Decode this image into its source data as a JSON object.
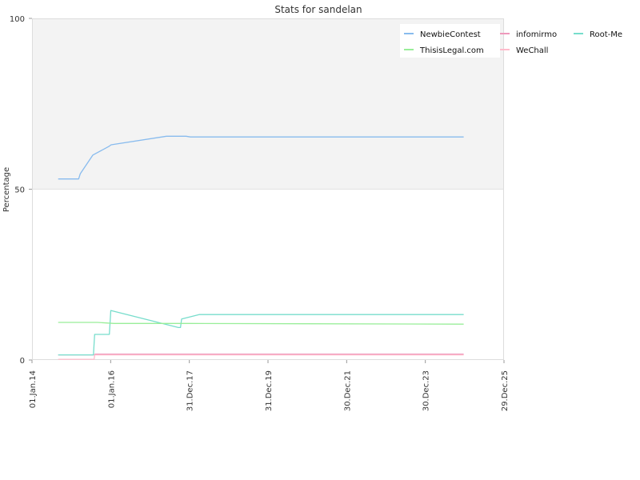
{
  "chart_data": {
    "type": "line",
    "title": "Stats for sandelan",
    "xlabel": "",
    "ylabel": "Percentage",
    "ylim": [
      0,
      100
    ],
    "yticks": [
      0,
      50,
      100
    ],
    "xlim": [
      "2014-01-01",
      "2025-12-29"
    ],
    "xticks": [
      {
        "date": "2014-01-01",
        "label": "01.Jan.14"
      },
      {
        "date": "2016-01-01",
        "label": "01.Jan.16"
      },
      {
        "date": "2017-12-31",
        "label": "31.Dec.17"
      },
      {
        "date": "2019-12-31",
        "label": "31.Dec.19"
      },
      {
        "date": "2021-12-30",
        "label": "30.Dec.21"
      },
      {
        "date": "2023-12-30",
        "label": "30.Dec.23"
      },
      {
        "date": "2025-12-29",
        "label": "29.Dec.25"
      }
    ],
    "background_bands": [
      {
        "from": 50,
        "to": 100,
        "color": "#f3f3f3"
      },
      {
        "from": 0,
        "to": 50,
        "color": "#ffffff"
      }
    ],
    "legend_position": "top-right",
    "series": [
      {
        "name": "NewbieContest",
        "color": "#88bbee",
        "points": [
          [
            "2014-09-01",
            53
          ],
          [
            "2015-03-10",
            53
          ],
          [
            "2015-03-25",
            54.5
          ],
          [
            "2015-07-20",
            60
          ],
          [
            "2015-12-15",
            62.5
          ],
          [
            "2016-01-05",
            63
          ],
          [
            "2017-06-01",
            65.5
          ],
          [
            "2017-12-01",
            65.5
          ],
          [
            "2018-01-10",
            65.3
          ],
          [
            "2024-12-20",
            65.3
          ]
        ]
      },
      {
        "name": "infomirmo",
        "color": "#ee99bb",
        "points": [
          [
            "2014-09-01",
            1.5
          ],
          [
            "2015-08-01",
            1.5
          ],
          [
            "2015-08-10",
            1.7
          ],
          [
            "2024-12-20",
            1.7
          ]
        ]
      },
      {
        "name": "Root-Me",
        "color": "#77ddcc",
        "points": [
          [
            "2014-09-01",
            1.5
          ],
          [
            "2015-07-25",
            1.5
          ],
          [
            "2015-08-05",
            7.5
          ],
          [
            "2015-12-20",
            7.5
          ],
          [
            "2016-01-02",
            14.5
          ],
          [
            "2017-09-20",
            9.5
          ],
          [
            "2017-10-10",
            9.5
          ],
          [
            "2017-10-20",
            12
          ],
          [
            "2018-04-01",
            13.3
          ],
          [
            "2024-12-20",
            13.3
          ]
        ]
      },
      {
        "name": "ThisisLegal.com",
        "color": "#99ee99",
        "points": [
          [
            "2014-09-01",
            11
          ],
          [
            "2015-09-01",
            11
          ],
          [
            "2016-02-01",
            10.7
          ],
          [
            "2018-01-01",
            10.7
          ],
          [
            "2024-12-20",
            10.5
          ]
        ]
      },
      {
        "name": "WeChall",
        "color": "#ffbbcc",
        "points": [
          [
            "2014-09-01",
            0.2
          ],
          [
            "2015-08-01",
            0.2
          ],
          [
            "2015-08-05",
            1.5
          ],
          [
            "2024-12-20",
            1.5
          ]
        ]
      }
    ]
  }
}
